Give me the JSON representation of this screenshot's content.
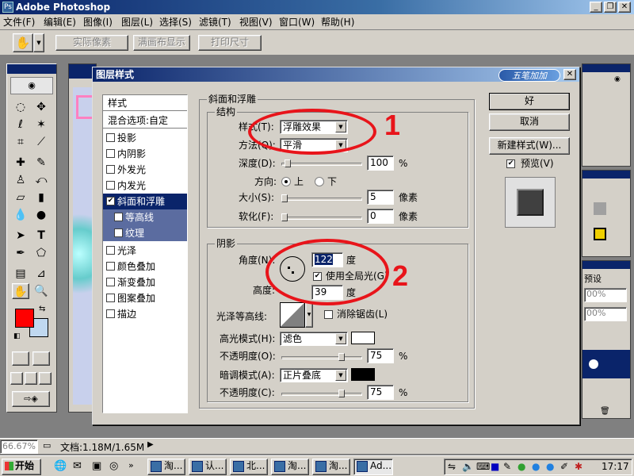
{
  "app": {
    "title": "Adobe Photoshop",
    "icon": "Ps"
  },
  "window_buttons": {
    "min": "_",
    "restore": "❐",
    "close": "✕"
  },
  "menu": [
    "文件(F)",
    "编辑(E)",
    "图像(I)",
    "图层(L)",
    "选择(S)",
    "滤镜(T)",
    "视图(V)",
    "窗口(W)",
    "帮助(H)"
  ],
  "options_bar": {
    "actual_pixels": "实际像素",
    "fit_screen": "满画布显示",
    "print_size": "打印尺寸"
  },
  "dialog": {
    "title": "图层样式",
    "logo": "五笔加加",
    "styles_list": [
      {
        "label": "样式",
        "kind": "head"
      },
      {
        "label": "混合选项:自定",
        "kind": "head"
      },
      {
        "label": "投影",
        "checked": false
      },
      {
        "label": "内阴影",
        "checked": false
      },
      {
        "label": "外发光",
        "checked": false
      },
      {
        "label": "内发光",
        "checked": false
      },
      {
        "label": "斜面和浮雕",
        "checked": true,
        "selected": true
      },
      {
        "label": "等高线",
        "checked": false,
        "sub": true
      },
      {
        "label": "纹理",
        "checked": false,
        "sub": true
      },
      {
        "label": "光泽",
        "checked": false
      },
      {
        "label": "颜色叠加",
        "checked": false
      },
      {
        "label": "渐变叠加",
        "checked": false
      },
      {
        "label": "图案叠加",
        "checked": false
      },
      {
        "label": "描边",
        "checked": false
      }
    ],
    "bevel": {
      "group_title": "斜面和浮雕",
      "structure_title": "结构",
      "style_label": "样式(T):",
      "style_value": "浮雕效果",
      "technique_label": "方法(Q):",
      "technique_value": "平滑",
      "depth_label": "深度(D):",
      "depth_value": "100",
      "depth_unit": "%",
      "direction_label": "方向:",
      "dir_up": "上",
      "dir_down": "下",
      "size_label": "大小(S):",
      "size_value": "5",
      "size_unit": "像素",
      "soften_label": "软化(F):",
      "soften_value": "0",
      "soften_unit": "像素"
    },
    "shading": {
      "title": "阴影",
      "angle_label": "角度(N):",
      "angle_value": "122",
      "angle_unit": "度",
      "global_light": "使用全局光(G)",
      "altitude_label": "高度:",
      "altitude_value": "39",
      "altitude_unit": "度",
      "gloss_label": "光泽等高线:",
      "antialias": "消除锯齿(L)",
      "highlight_mode_label": "高光模式(H):",
      "highlight_mode": "滤色",
      "highlight_color": "#ffffff",
      "hl_opacity_label": "不透明度(O):",
      "hl_opacity": "75",
      "shadow_mode_label": "暗调模式(A):",
      "shadow_mode": "正片叠底",
      "shadow_color": "#000000",
      "sh_opacity_label": "不透明度(C):",
      "sh_opacity": "75",
      "pct": "%"
    },
    "buttons": {
      "ok": "好",
      "cancel": "取消",
      "new_style": "新建样式(W)...",
      "preview": "预览(V)"
    },
    "annotations": [
      "1",
      "2"
    ]
  },
  "panels": {
    "layers_tab": "预设",
    "pct1": "00%",
    "pct2": "00%"
  },
  "status": {
    "zoom": "66.67%",
    "doc": "文档:1.18M/1.65M"
  },
  "taskbar": {
    "start": "开始",
    "tasks": [
      "淘...",
      "认...",
      "北...",
      "淘...",
      "淘...",
      "Ad..."
    ],
    "clock": "17:17"
  },
  "colors": {
    "foreground": "#ff0000",
    "background": "#c0d8f0",
    "accent": "#0a246a",
    "annotation": "#e8141a"
  }
}
